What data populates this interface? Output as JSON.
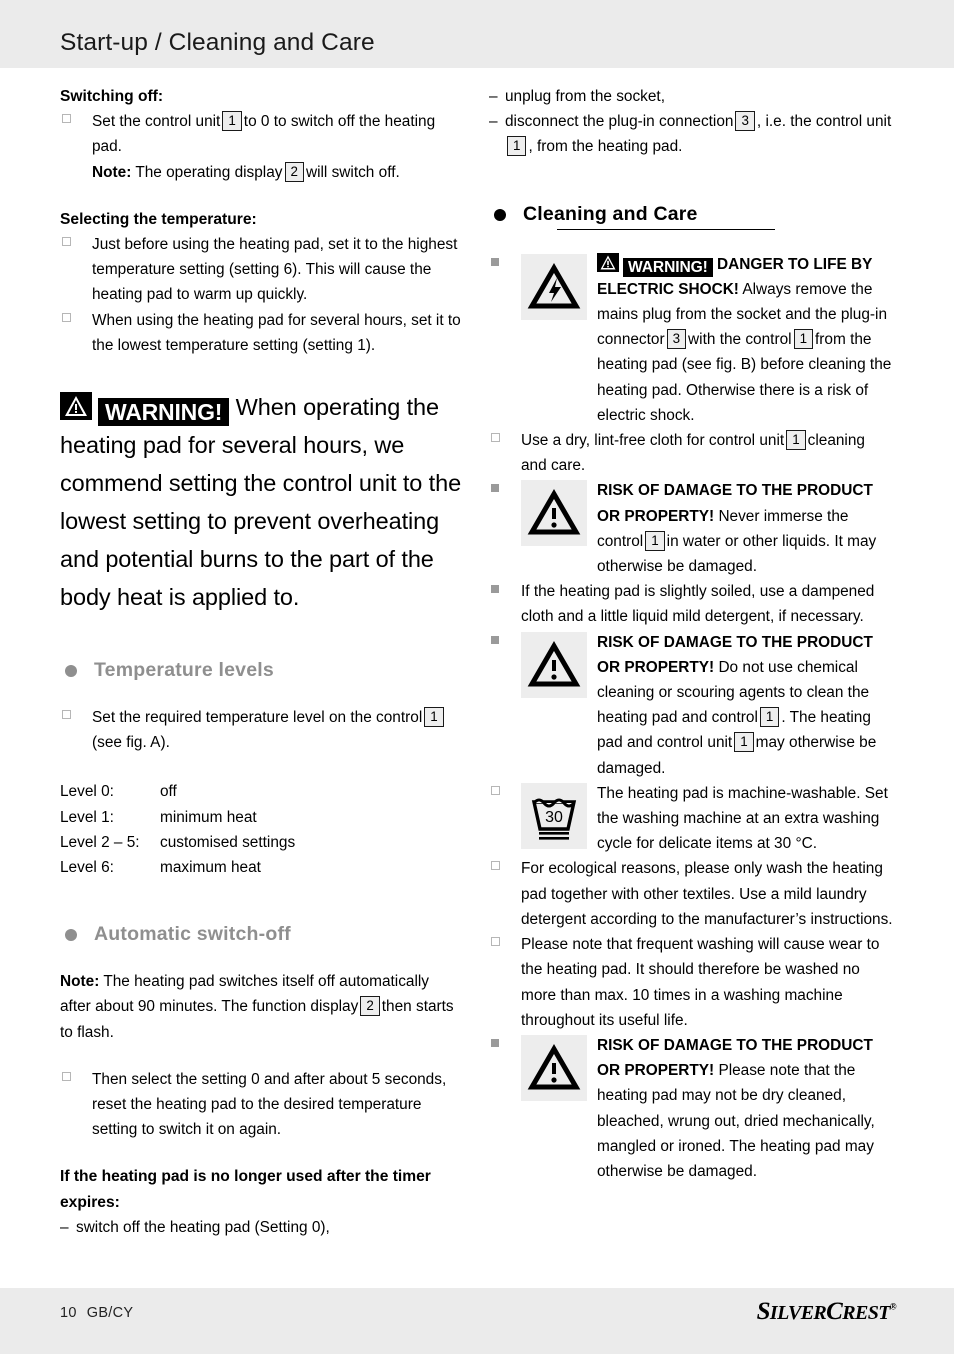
{
  "header": {
    "title": "Start-up / Cleaning and Care"
  },
  "footer": {
    "page_number": "10",
    "language_code": "GB/CY",
    "brand_part1": "S",
    "brand_part2": "ILVER",
    "brand_part3": "C",
    "brand_part4": "REST",
    "brand_reg": "®"
  },
  "left": {
    "switching_off_heading": "Switching off:",
    "switch_item_a": "Set the control unit",
    "switch_item_a2": "to 0 to switch off the heating pad.",
    "ref_1": "1",
    "ref_2": "2",
    "ref_3": "3",
    "note_label": "Note:",
    "note_text_a": "The operating display",
    "note_text_b": "will switch off.",
    "selecting_heading": "Selecting the temperature:",
    "select_item_1": "Just before using the heating pad, set it to the highest temperature setting (setting 6). This will cause the heating pad to warm up quickly.",
    "select_item_2": "When using the heating pad for several hours, set it to the lowest temperature setting (setting 1).",
    "warning_word": "WARNING!",
    "warning_body": "When operating the heating pad for several hours, we commend setting the control unit to the lowest setting to prevent overheating and potential burns to the part of the body heat is applied to.",
    "temperature_levels_heading": "Temperature levels",
    "temp_item_a": "Set the required temperature level on the con-trol",
    "temp_item_a1": "Set the required temperature level on the control",
    "temp_item_a2": "(see fig. A).",
    "levels": [
      {
        "key": "Level 0:",
        "value": "off"
      },
      {
        "key": "Level 1:",
        "value": "minimum heat"
      },
      {
        "key": "Level 2 – 5:",
        "value": "customised settings"
      },
      {
        "key": "Level 6:",
        "value": "maximum heat"
      }
    ],
    "auto_switch_heading": "Automatic switch-off",
    "auto_note_label": "Note:",
    "auto_note_a": "The heating pad switches itself off automatically after about 90 minutes. The function display",
    "auto_note_b": "then starts to flash.",
    "auto_item": "Then select the setting 0 and after about 5 seconds, reset the heating pad to the desired temperature setting to switch it on again.",
    "timer_heading": "If the heating pad is no longer used after the timer expires:",
    "timer_item": "switch off the heating pad (Setting 0),"
  },
  "right": {
    "dash_item_1": "unplug from the socket,",
    "dash_item_2a": "disconnect the plug-in connection",
    "dash_item_2b": ", i.e. the control unit",
    "dash_item_2c": ", from the heating pad.",
    "cleaning_heading": "Cleaning and Care",
    "warning_word": "WARNING!",
    "shock_title": "DANGER TO LIFE BY ELECTRIC SHOCK!",
    "shock_body_a": "Always remove the mains plug from the socket and the plug-in connector",
    "shock_body_b": "with the control",
    "shock_body_c": "from the heating pad (see fig. B) before cleaning the heating pad. Otherwise there is a risk of electric shock.",
    "cloth_item_a": "Use a dry, lint-free cloth for control unit",
    "cloth_item_b": "cleaning and care.",
    "risk1_title": "RISK OF DAMAGE TO THE PRODUCT OR PROPERTY!",
    "risk1_body_a": "Never immerse the control",
    "risk1_body_b": "in water or other liquids. It may otherwise be damaged.",
    "soiled_item": "If the heating pad is slightly soiled, use a dampened cloth and a little liquid mild detergent, if necessary.",
    "risk2_title": "RISK OF DAMAGE TO THE PRODUCT OR PROPERTY!",
    "risk2_body_a": "Do not use chemical cleaning or scouring agents to clean the heating pad and control",
    "risk2_body_b": ". The heating pad and control unit",
    "risk2_body_c": "may otherwise be damaged.",
    "wash_item": "The heating pad is machine-washable. Set the washing machine at an extra washing cycle for delicate items at 30 °C.",
    "wash_temp": "30",
    "eco_item": "For ecological reasons, please only wash the heating pad together with other textiles. Use a mild laundry detergent according to the manufacturer’s instructions.",
    "frequent_item": "Please note that frequent washing will cause wear to the heating pad. It should therefore be washed no more than max. 10 times in a washing machine throughout its useful life.",
    "risk3_title": "RISK OF DAMAGE TO THE PRODUCT OR PROPERTY!",
    "risk3_body": "Please note that the heating pad may not be dry cleaned, bleached, wrung out, dried mechanically, mangled or ironed. The heating pad may otherwise be damaged.",
    "ref_1": "1",
    "ref_3": "3"
  },
  "colors": {
    "band": "#ebebeb",
    "bullet_grey": "#9a9a9a",
    "heading_grey": "#8f8f8f",
    "icon_bg": "#ededed"
  }
}
